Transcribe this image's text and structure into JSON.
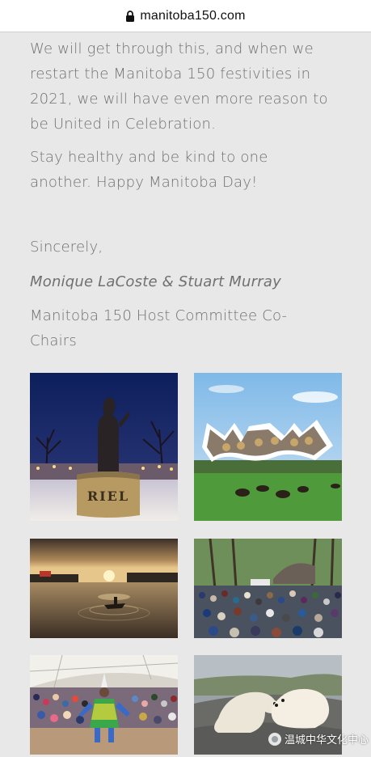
{
  "browser": {
    "url": "manitoba150.com",
    "lock_icon": "lock-icon"
  },
  "letter": {
    "paragraph_1_lines": [
      "We will get through this, and when we",
      "restart the Manitoba 150 festivities in",
      "2021, we will have even more reason to",
      "be United in Celebration."
    ],
    "paragraph_2_lines": [
      "Stay healthy and be kind to one",
      "another. Happy Manitoba Day!"
    ],
    "closing": "Sincerely,",
    "signers": "Monique LaCoste & Stuart Murray",
    "title_lines": [
      "Manitoba 150 Host Committee Co-",
      "Chairs"
    ]
  },
  "photos": {
    "riel_statue": {
      "plaque_text": "RIEL"
    }
  },
  "watermark": {
    "text": "温城中华文化中心"
  }
}
